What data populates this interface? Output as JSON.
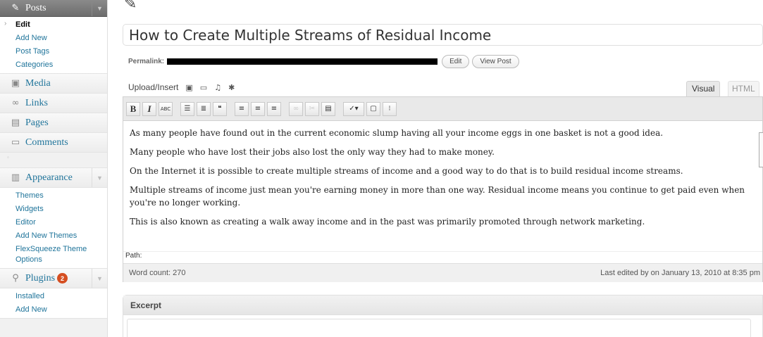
{
  "sidebar": {
    "posts": {
      "label": "Posts",
      "icon": "pin-icon"
    },
    "posts_items": [
      "Edit",
      "Add New",
      "Post Tags",
      "Categories"
    ],
    "media": "Media",
    "links": "Links",
    "pages": "Pages",
    "comments": "Comments",
    "appearance": "Appearance",
    "appearance_items": [
      "Themes",
      "Widgets",
      "Editor",
      "Add New Themes",
      "FlexSqueeze Theme Options"
    ],
    "plugins": "Plugins",
    "plugins_badge": "2",
    "plugins_items": [
      "Installed",
      "Add New"
    ]
  },
  "editor": {
    "post_title": "How to Create Multiple Streams of Residual Income",
    "permalink_label": "Permalink:",
    "edit_button": "Edit",
    "view_post_button": "View Post",
    "upload_insert": "Upload/Insert",
    "tab_visual": "Visual",
    "tab_html": "HTML",
    "paragraphs": [
      "As many people have found out in the current economic slump having all your income eggs in one basket is not a good idea.",
      "Many people who have lost their jobs also lost the only way they had to make money.",
      "On the Internet it is possible to create multiple streams of income and a good way to do that is to build residual income streams.",
      "Multiple streams of income just mean you're earning money in more than one way. Residual income means you continue to get paid even when you're no longer working.",
      "This is also known as creating a walk away income and in the past was primarily promoted through network marketing."
    ],
    "path_label": "Path:",
    "word_count": "Word count: 270",
    "last_edited": "Last edited by on January 13, 2010 at 8:35 pm"
  },
  "excerpt": {
    "title": "Excerpt"
  },
  "colors": {
    "link": "#21759b",
    "badge": "#d54e21",
    "menu_dark": "#6d6d6d"
  }
}
